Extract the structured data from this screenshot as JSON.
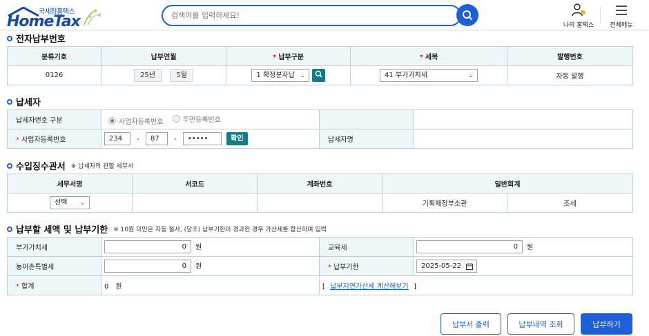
{
  "header": {
    "logo_sub": "국세청홈택스",
    "logo_main": "HomeTax",
    "search_placeholder": "검색어를 입력하세요!",
    "my_hometax_label": "나의 홈택스",
    "all_menu_label": "전체메뉴"
  },
  "section1": {
    "title": "전자납부번호",
    "headers": [
      "분류기호",
      "납부연월",
      "납부구분",
      "세목",
      "발행번호"
    ],
    "code": "0126",
    "year": "25년",
    "month": "5월",
    "payment_type": "1 확정분자납",
    "tax_item": "41 부가가치세",
    "issue_no": "자동 발행"
  },
  "section2": {
    "title": "납세자",
    "id_type_label": "납세자번호 구분",
    "radio_business": "사업자등록번호",
    "radio_resident": "주민등록번호",
    "biz_no_label": "사업자등록번호",
    "biz_no_1": "234",
    "biz_no_2": "87",
    "biz_no_3": "•••••",
    "dash": "-",
    "confirm_label": "확인",
    "name_label": "납세자명",
    "name_value": ""
  },
  "section3": {
    "title": "수입징수관서",
    "note": "※ 납세자의 관할 세무서",
    "headers": [
      "세무서명",
      "서코드",
      "계좌번호",
      "일반회계"
    ],
    "office_select": "선택",
    "office_code": "",
    "account_no": "",
    "general_account_1": "기획재정부소관",
    "general_account_2": "조세"
  },
  "section4": {
    "title": "납부할 세액 및 납부기한",
    "note": "※ 10원 미만은 자동 절사, (당초) 납부기한이 경과한 경우 가산세를 합산하여 입력",
    "vat_label": "부가가치세",
    "vat_value": "0",
    "edu_label": "교육세",
    "edu_value": "0",
    "rural_label": "농어촌특별세",
    "rural_value": "0",
    "due_label": "납부기한",
    "due_value": "2025-05-22",
    "total_label": "합계",
    "total_value": "0",
    "unit": "원",
    "late_calc_link": "납부지연가산세 계산해보기",
    "bracket_open": "[",
    "bracket_close": "]"
  },
  "buttons": {
    "print": "납부서 출력",
    "history": "납부내역 조회",
    "pay": "납부하기"
  },
  "colors": {
    "primary": "#1d5fd6",
    "teal": "#157c86",
    "header_bg": "#eef6f7",
    "border": "#b9d3d7",
    "required": "#d8232a"
  }
}
